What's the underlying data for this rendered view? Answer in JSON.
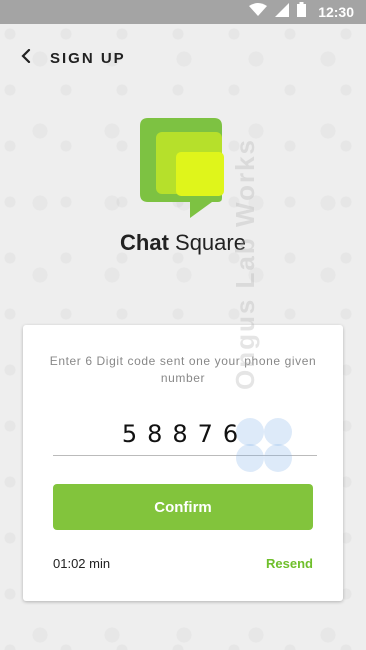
{
  "status_bar": {
    "time": "12:30",
    "icons": [
      "wifi-icon",
      "signal-icon",
      "battery-icon"
    ]
  },
  "header": {
    "title": "SIGN UP",
    "back_icon": "chevron-left-icon"
  },
  "brand": {
    "name_bold": "Chat",
    "name_regular": " Square",
    "colors": {
      "outer": "#7dc242",
      "middle": "#b6e02b",
      "inner": "#dff51b"
    }
  },
  "verification": {
    "instructions": "Enter 6 Digit code sent one your phone given number",
    "code_value": "58876",
    "confirm_label": "Confirm",
    "timer": "01:02 min",
    "resend_label": "Resend"
  },
  "watermark": {
    "text": "Ongus Lab Works"
  },
  "colors": {
    "accent": "#82c43c",
    "resend": "#6fbf2b",
    "status_bar": "#a4a4a4"
  }
}
